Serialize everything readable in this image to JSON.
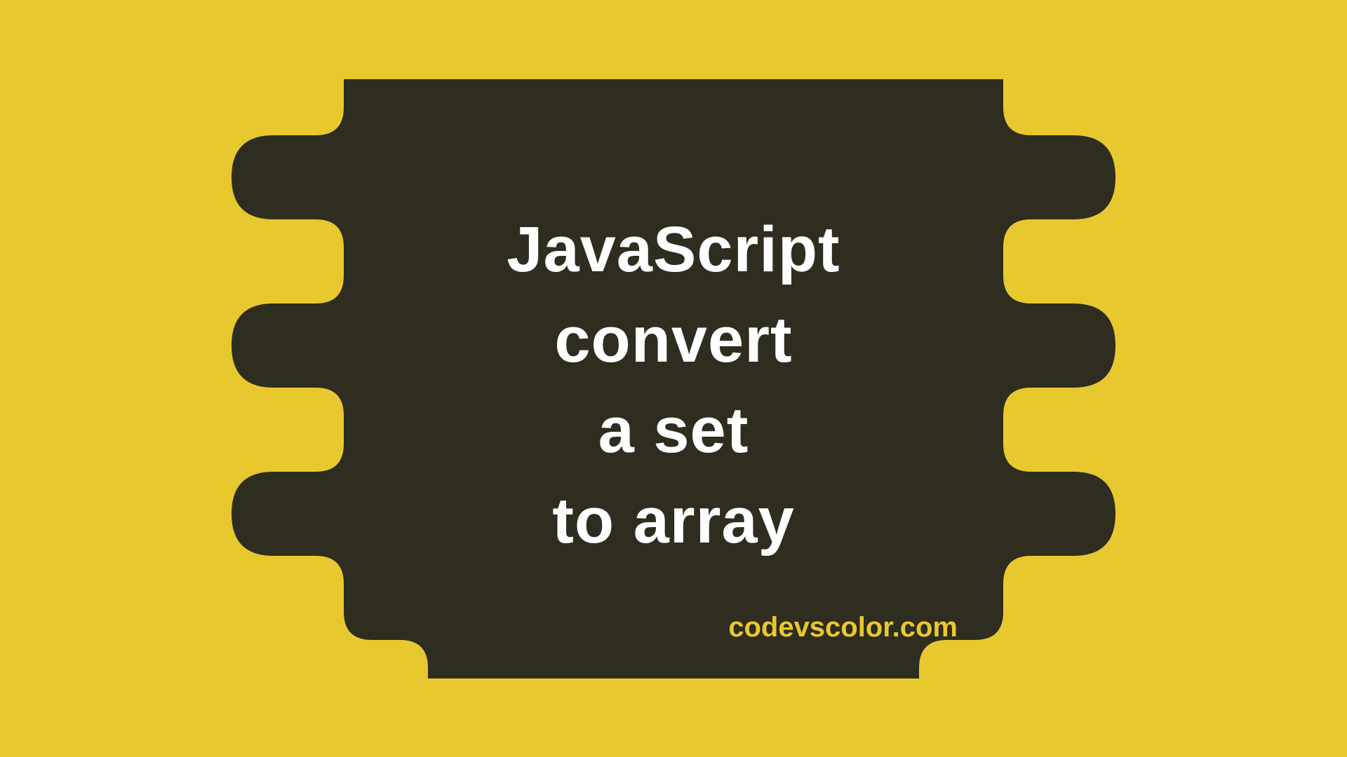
{
  "title": {
    "line1": "JavaScript",
    "line2": "convert",
    "line3": "a set",
    "line4": "to array"
  },
  "website": "codevscolor.com",
  "colors": {
    "background": "#e8c82f",
    "blob": "#2f2d20",
    "titleText": "#ffffff",
    "websiteText": "#e8c82f"
  }
}
